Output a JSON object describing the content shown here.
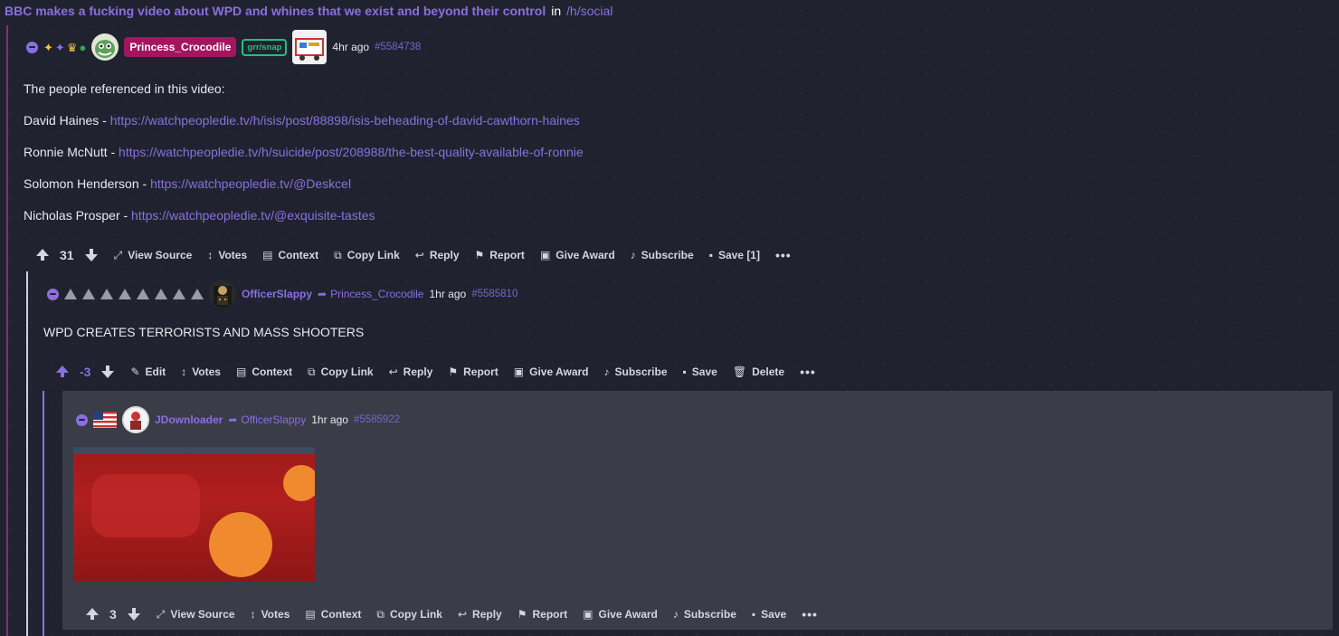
{
  "post": {
    "title": "BBC makes a fucking video about WPD and whines that we exist and beyond their control",
    "in_label": "in",
    "sub": "/h/social"
  },
  "c1": {
    "username": "Princess_Crocodile",
    "flair": "grr/snap",
    "time": "4hr ago",
    "id": "#5584738",
    "intro": "The people referenced in this video:",
    "lines": [
      {
        "name": "David Haines - ",
        "link": "https://watchpeopledie.tv/h/isis/post/88898/isis-beheading-of-david-cawthorn-haines"
      },
      {
        "name": "Ronnie McNutt - ",
        "link": "https://watchpeopledie.tv/h/suicide/post/208988/the-best-quality-available-of-ronnie"
      },
      {
        "name": "Solomon Henderson - ",
        "link": "https://watchpeopledie.tv/@Deskcel"
      },
      {
        "name": "Nicholas Prosper - ",
        "link": "https://watchpeopledie.tv/@exquisite-tastes"
      }
    ],
    "score": "31",
    "actions": {
      "view_source": "View Source",
      "votes": "Votes",
      "context": "Context",
      "copy_link": "Copy Link",
      "reply": "Reply",
      "report": "Report",
      "give_award": "Give Award",
      "subscribe": "Subscribe",
      "save": "Save [1]",
      "more": "•••"
    }
  },
  "c2": {
    "username": "OfficerSlappy",
    "reply_to": "Princess_Crocodile",
    "time": "1hr ago",
    "id": "#5585810",
    "text": "WPD CREATES TERRORISTS AND MASS SHOOTERS",
    "score": "-3",
    "actions": {
      "edit": "Edit",
      "votes": "Votes",
      "context": "Context",
      "copy_link": "Copy Link",
      "reply": "Reply",
      "report": "Report",
      "give_award": "Give Award",
      "subscribe": "Subscribe",
      "save": "Save",
      "delete": "Delete",
      "more": "•••"
    }
  },
  "c3": {
    "username": "JDownloader",
    "reply_to": "OfficerSlappy",
    "time": "1hr ago",
    "id": "#5585922",
    "score": "3",
    "actions": {
      "view_source": "View Source",
      "votes": "Votes",
      "context": "Context",
      "copy_link": "Copy Link",
      "reply": "Reply",
      "report": "Report",
      "give_award": "Give Award",
      "subscribe": "Subscribe",
      "save": "Save",
      "more": "•••"
    }
  },
  "colors": {
    "accent": "#8b6fe0",
    "username_pill": "#a3165f",
    "flair": "#20c27f",
    "background": "#20232f",
    "highlight": "#3a3c48"
  }
}
